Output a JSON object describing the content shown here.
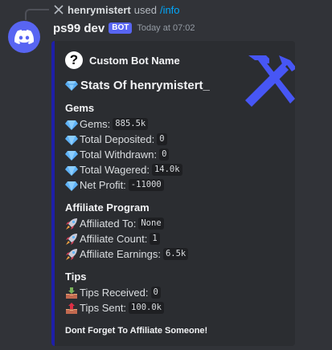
{
  "reply": {
    "user": "henrymistert",
    "used": "used",
    "command": "/info"
  },
  "message": {
    "bot_name": "ps99 dev",
    "badge": "BOT",
    "timestamp": "Today at 07:02"
  },
  "embed": {
    "accent_color": "#1e1fa8",
    "author": "Custom Bot Name",
    "title": "Stats Of henrymistert_",
    "sections": {
      "gems": {
        "name": "Gems",
        "lines": [
          {
            "label": "Gems:",
            "value": "885.5k",
            "icon": "gem-icon"
          },
          {
            "label": "Total Deposited:",
            "value": "0",
            "icon": "gem-icon"
          },
          {
            "label": "Total Withdrawn:",
            "value": "0",
            "icon": "gem-icon"
          },
          {
            "label": "Total Wagered:",
            "value": "14.0k",
            "icon": "gem-icon"
          },
          {
            "label": "Net Profit:",
            "value": "-11000",
            "icon": "gem-icon"
          }
        ]
      },
      "affiliate": {
        "name": "Affiliate Program",
        "lines": [
          {
            "label": "Affiliated To:",
            "value": "None",
            "icon": "rocket-icon"
          },
          {
            "label": "Affiliate Count:",
            "value": "1",
            "icon": "rocket-icon"
          },
          {
            "label": "Affiliate Earnings:",
            "value": "6.5k",
            "icon": "rocket-icon"
          }
        ]
      },
      "tips": {
        "name": "Tips",
        "lines": [
          {
            "label": "Tips Received:",
            "value": "0",
            "icon": "inbox-tray-icon"
          },
          {
            "label": "Tips Sent:",
            "value": "100.0k",
            "icon": "outbox-tray-icon"
          }
        ]
      }
    },
    "footer_note": "Dont Forget To Affiliate Someone!"
  }
}
